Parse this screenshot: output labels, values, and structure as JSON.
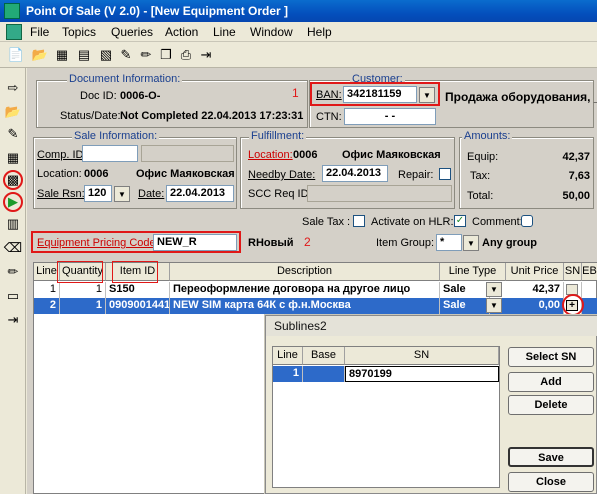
{
  "window": {
    "title": "Point Of Sale  (V 2.0) - [New Equipment Order  ]"
  },
  "menu": [
    "File",
    "Topics",
    "Queries",
    "Action",
    "Line",
    "Window",
    "Help"
  ],
  "document": {
    "section_title": "Document Information:",
    "doc_id_label": "Doc ID:",
    "doc_id": "0006-O-",
    "status_label": "Status/Date:",
    "status": "Not Completed 22.04.2013 17:23:31"
  },
  "customer": {
    "section_title": "Customer:",
    "ban_label": "BAN:",
    "ban_value": "342181159",
    "ctn_label": "CTN:",
    "ctn_value": "-   -",
    "description": "Продажа оборудования, _"
  },
  "sale": {
    "section_title": "Sale Information:",
    "comp_id_label": "Comp. ID:",
    "location_label": "Location:",
    "location_code": "0006",
    "location_name": "Офис Маяковская",
    "sale_rsn_label": "Sale Rsn:",
    "sale_rsn_value": "120",
    "date_label": "Date:",
    "date_value": "22.04.2013"
  },
  "fulfillment": {
    "section_title": "Fulfillment:",
    "location_label": "Location:",
    "location_code": "0006",
    "location_name": "Офис Маяковская",
    "needby_label": "Needby Date:",
    "needby_value": "22.04.2013",
    "repair_label": "Repair:",
    "scc_label": "SCC Req ID:"
  },
  "amounts": {
    "section_title": "Amounts:",
    "equip_label": "Equip:",
    "equip_value": "42,37",
    "tax_label": "Tax:",
    "tax_value": "7,63",
    "total_label": "Total:",
    "total_value": "50,00"
  },
  "options": {
    "sale_tax_label": "Sale Tax :",
    "hlr_label": "Activate on HLR:",
    "comment_label": "Comment:"
  },
  "pricing": {
    "label": "Equipment Pricing Code:",
    "value": "NEW_R",
    "description": "RНовый",
    "item_group_label": "Item Group:",
    "item_group_value": "*",
    "item_group_desc": "Any group"
  },
  "annotations": {
    "n1": "1",
    "n2": "2"
  },
  "grid": {
    "headers": [
      "Line",
      "Quantity",
      "Item ID",
      "Description",
      "Line Type",
      "Unit Price",
      "SN",
      "EB"
    ],
    "rows": [
      {
        "line": "1",
        "qty": "1",
        "item_id": "S150",
        "description": "Переоформление договора на другое лицо",
        "line_type": "Sale",
        "unit_price": "42,37",
        "sn": ""
      },
      {
        "line": "2",
        "qty": "1",
        "item_id": "0909001441",
        "description": "NEW SIM карта 64К с ф.н.Москва",
        "line_type": "Sale",
        "unit_price": "0,00",
        "sn": "+"
      }
    ]
  },
  "dialog": {
    "title": "Sublines2",
    "headers": [
      "Line",
      "Base",
      "SN"
    ],
    "rows": [
      {
        "line": "1",
        "base": "",
        "sn": "8970199"
      }
    ],
    "select_sn": "Select SN",
    "add": "Add",
    "delete": "Delete",
    "save": "Save",
    "close": "Close"
  },
  "colors": {
    "accent_red": "#e01818",
    "selection_blue": "#2d6ac9",
    "title_blue": "#0450bd"
  }
}
